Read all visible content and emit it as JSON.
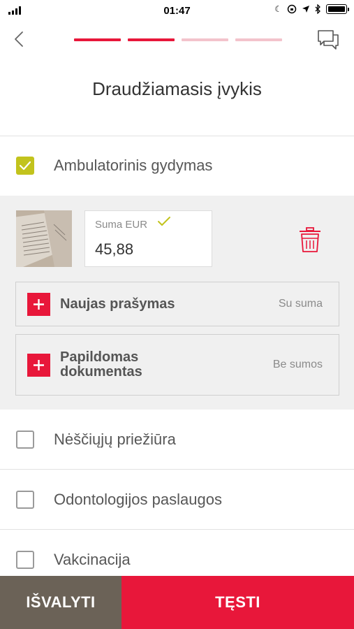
{
  "status_bar": {
    "time": "01:47",
    "icons": [
      "signal-icon",
      "moon-icon",
      "rotation-lock-icon",
      "location-icon",
      "bluetooth-icon",
      "battery-icon"
    ]
  },
  "header": {
    "title": "Draudžiamasis įvykis",
    "progress": {
      "steps": 4,
      "completed": 2
    },
    "icons": [
      "back-chevron-icon",
      "chat-icon"
    ]
  },
  "categories": [
    {
      "label": "Ambulatorinis gydymas",
      "checked": true
    },
    {
      "label": "Nėščiųjų priežiūra",
      "checked": false
    },
    {
      "label": "Odontologijos paslaugos",
      "checked": false
    },
    {
      "label": "Vakcinacija",
      "checked": false
    }
  ],
  "claim": {
    "amount_label": "Suma EUR",
    "amount_value": "45,88",
    "new_request": {
      "title": "Naujas prašymas",
      "hint": "Su suma"
    },
    "extra_document": {
      "title_line1": "Papildomas",
      "title_line2": "dokumentas",
      "hint": "Be sumos"
    }
  },
  "footer": {
    "clear_label": "IŠVALYTI",
    "next_label": "TĘSTI"
  },
  "colors": {
    "accent_red": "#e8173a",
    "progress_inactive": "#f3c3cc",
    "check_green": "#c2c31d",
    "clear_button": "#6b6257",
    "panel_bg": "#f0f0f0"
  }
}
